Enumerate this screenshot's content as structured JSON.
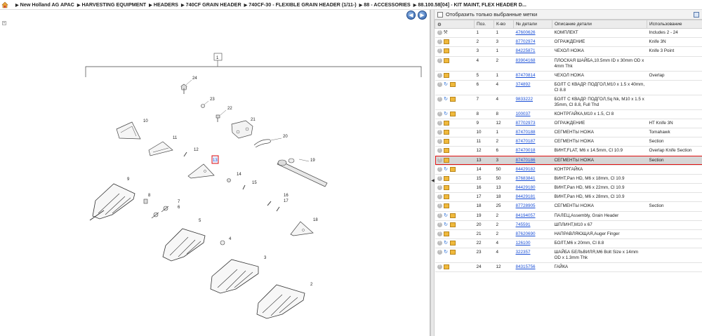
{
  "breadcrumbs": [
    "New Holland AG APAC",
    "HARVESTING EQUIPMENT",
    "HEADERS",
    "740CF GRAIN HEADER",
    "740CF-30 - FLEXIBLE GRAIN HEADER (1/11-)",
    "88 - ACCESSORIES",
    "88.100.58[04] - KIT MAINT, FLEX HEADER D..."
  ],
  "filter_label": "Отобразить только выбранные метки",
  "columns": {
    "pos": "Поз.",
    "qty": "К-во",
    "part": "№ детали",
    "desc": "Описание детали",
    "use": "Использование"
  },
  "rows": [
    {
      "icons": [
        "q",
        "wrench"
      ],
      "pos": "1",
      "qty": "1",
      "part": "47600626",
      "desc": "КОМПЛЕКТ",
      "use": "Includes 2 - 24"
    },
    {
      "icons": [
        "q",
        "box"
      ],
      "pos": "2",
      "qty": "3",
      "part": "87702974",
      "desc": "ОГРАЖДЕНИЕ",
      "use": "Knife 3N"
    },
    {
      "icons": [
        "q",
        "box"
      ],
      "pos": "3",
      "qty": "1",
      "part": "84225871",
      "desc": "ЧЕХОЛ НОЖА",
      "use": "Knife 3 Point"
    },
    {
      "icons": [
        "q",
        "box"
      ],
      "pos": "4",
      "qty": "2",
      "part": "83904168",
      "desc": "ПЛОСКАЯ ШАЙБА,10.5mm ID x 30mm OD x 4mm Thk",
      "use": ""
    },
    {
      "icons": [
        "q",
        "box"
      ],
      "pos": "5",
      "qty": "1",
      "part": "87470814",
      "desc": "ЧЕХОЛ НОЖА",
      "use": "Overlap"
    },
    {
      "icons": [
        "q",
        "arrow",
        "box"
      ],
      "pos": "6",
      "qty": "4",
      "part": "374892",
      "desc": "БОЛТ С КВАДР. ПОДГОЛ,M10 x 1.5 x 40mm, Cl 8.8",
      "use": ""
    },
    {
      "icons": [
        "q",
        "arrow",
        "box"
      ],
      "pos": "7",
      "qty": "4",
      "part": "9833222",
      "desc": "БОЛТ С КВАДР. ПОДГОЛ,Sq Nk, M10 x 1.5 x 35mm, Cl 8.8, Full Thd",
      "use": ""
    },
    {
      "icons": [
        "q",
        "arrow",
        "box"
      ],
      "pos": "8",
      "qty": "8",
      "part": "100037",
      "desc": "КОНТРГАЙКА,M10 x 1.5, Cl 8",
      "use": ""
    },
    {
      "icons": [
        "q",
        "box"
      ],
      "pos": "9",
      "qty": "12",
      "part": "87702973",
      "desc": "ОГРАЖДЕНИЕ",
      "use": "HT Knife 3N"
    },
    {
      "icons": [
        "q",
        "box"
      ],
      "pos": "10",
      "qty": "1",
      "part": "87470188",
      "desc": "СЕГМЕНТЫ НОЖА",
      "use": "Tomahawk"
    },
    {
      "icons": [
        "q",
        "box"
      ],
      "pos": "11",
      "qty": "2",
      "part": "87470187",
      "desc": "СЕГМЕНТЫ НОЖА",
      "use": "Section"
    },
    {
      "icons": [
        "q",
        "box"
      ],
      "pos": "12",
      "qty": "6",
      "part": "87470018",
      "desc": "ВИНТ,FLAT, M6 x 14.5mm, Cl 10.9",
      "use": "Overlap Knife Section"
    },
    {
      "icons": [
        "q",
        "box"
      ],
      "pos": "13",
      "qty": "3",
      "part": "87470186",
      "desc": "СЕГМЕНТЫ НОЖА",
      "use": "Section",
      "selected": true
    },
    {
      "icons": [
        "q",
        "arrow",
        "box"
      ],
      "pos": "14",
      "qty": "50",
      "part": "84429182",
      "desc": "КОНТРГАЙКА",
      "use": ""
    },
    {
      "icons": [
        "q",
        "box"
      ],
      "pos": "15",
      "qty": "50",
      "part": "87683841",
      "desc": "ВИНТ,Pan HD, M6 x 18mm, Cl 10.9",
      "use": ""
    },
    {
      "icons": [
        "q",
        "box"
      ],
      "pos": "16",
      "qty": "13",
      "part": "84429180",
      "desc": "ВИНТ,Pan HD, M6 x 22mm, Cl 10.9",
      "use": ""
    },
    {
      "icons": [
        "q",
        "box"
      ],
      "pos": "17",
      "qty": "18",
      "part": "84429181",
      "desc": "ВИНТ,Pan HD, M6 x 28mm, Cl 10.9",
      "use": ""
    },
    {
      "icons": [
        "q",
        "box"
      ],
      "pos": "18",
      "qty": "25",
      "part": "87728905",
      "desc": "СЕГМЕНТЫ НОЖА",
      "use": "Section"
    },
    {
      "icons": [
        "q",
        "arrow",
        "box"
      ],
      "pos": "19",
      "qty": "2",
      "part": "84194057",
      "desc": "ПАЛЕЦ,Assembly, Grain Header",
      "use": ""
    },
    {
      "icons": [
        "q",
        "arrow",
        "box"
      ],
      "pos": "20",
      "qty": "2",
      "part": "745591",
      "desc": "ШПЛИНТ,M10 x 67",
      "use": ""
    },
    {
      "icons": [
        "q",
        "box"
      ],
      "pos": "21",
      "qty": "2",
      "part": "87620690",
      "desc": "НАПРАВЛЯЮЩАЯ,Auger Finger",
      "use": ""
    },
    {
      "icons": [
        "q",
        "arrow",
        "box"
      ],
      "pos": "22",
      "qty": "4",
      "part": "126100",
      "desc": "БОЛТ,M6 x 20mm, Cl 8.8",
      "use": ""
    },
    {
      "icons": [
        "q",
        "arrow",
        "box"
      ],
      "pos": "23",
      "qty": "4",
      "part": "322357",
      "desc": "ШАЙБА БЕЛЬВИЛЯ,M6 Bolt Size x 14mm OD x 1.3mm Thk",
      "use": ""
    },
    {
      "icons": [
        "q",
        "box"
      ],
      "pos": "24",
      "qty": "12",
      "part": "84315756",
      "desc": "ГАЙКА",
      "use": ""
    }
  ],
  "callouts": [
    "1",
    "2",
    "3",
    "4",
    "5",
    "6",
    "7",
    "8",
    "9",
    "10",
    "11",
    "12",
    "13",
    "14",
    "15",
    "16",
    "17",
    "18",
    "19",
    "20",
    "21",
    "22",
    "23",
    "24"
  ],
  "colors": {
    "link": "#1a4fd6",
    "selection_outline": "#e01010",
    "nav_button": "#2d5fa8"
  }
}
